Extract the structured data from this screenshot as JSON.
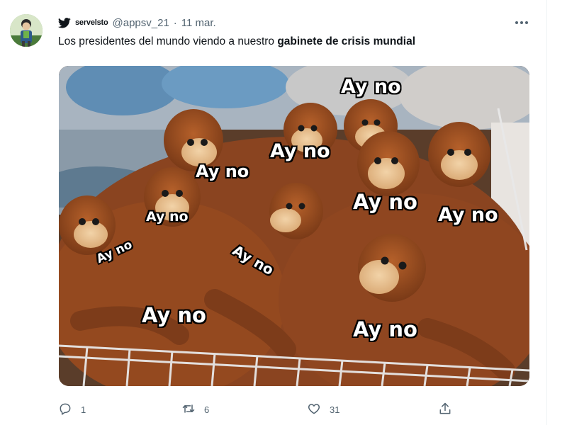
{
  "tweet": {
    "display_name": "servelsto",
    "handle": "@appsv_21",
    "separator": "·",
    "date": "11 mar.",
    "text_part1": "Los presidentes del mundo viendo a nuestro ",
    "text_bold": "gabinete de crisis mundial"
  },
  "image": {
    "captions": [
      "Ay no",
      "Ay no",
      "Ay no",
      "Ay no",
      "Ay no",
      "Ay no",
      "Ay no",
      "Ay no",
      "Ay no",
      "Ay no"
    ]
  },
  "actions": {
    "reply_count": "1",
    "retweet_count": "6",
    "like_count": "31"
  },
  "colors": {
    "twitter_blue": "#1d9bf0",
    "secondary_text": "#536471",
    "primary_text": "#0f1419"
  },
  "icons": [
    "twitter-bird-icon",
    "more-options-icon",
    "reply-icon",
    "retweet-icon",
    "like-icon",
    "share-icon"
  ]
}
